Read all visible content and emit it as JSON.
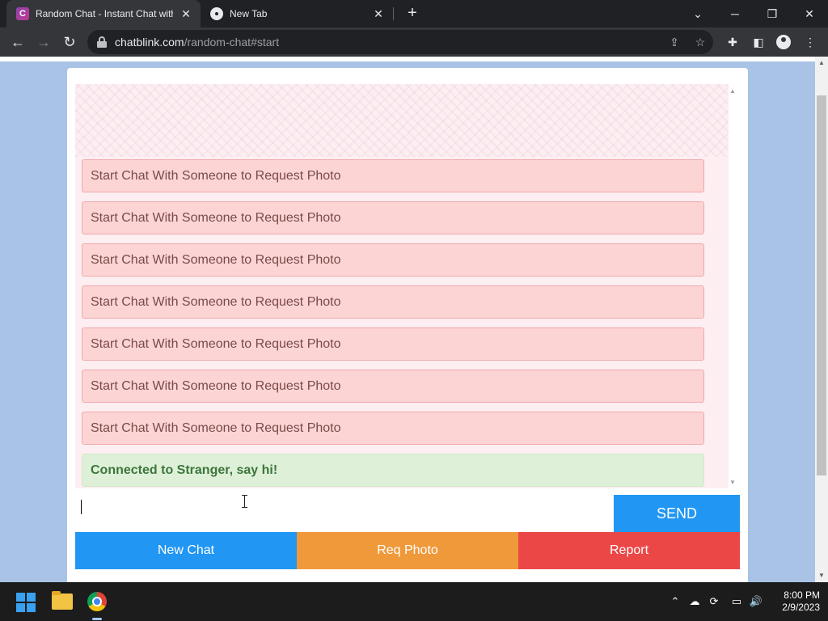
{
  "browser": {
    "tabs": [
      {
        "title": "Random Chat - Instant Chat with",
        "favicon_letter": "C",
        "active": true
      },
      {
        "title": "New Tab",
        "active": false
      }
    ],
    "new_tab_symbol": "+",
    "url_host": "chatblink.com",
    "url_path": "/random-chat#start"
  },
  "chat": {
    "messages": [
      {
        "type": "system-photo",
        "text": "Start Chat With Someone to Request Photo"
      },
      {
        "type": "system-photo",
        "text": "Start Chat With Someone to Request Photo"
      },
      {
        "type": "system-photo",
        "text": "Start Chat With Someone to Request Photo"
      },
      {
        "type": "system-photo",
        "text": "Start Chat With Someone to Request Photo"
      },
      {
        "type": "system-photo",
        "text": "Start Chat With Someone to Request Photo"
      },
      {
        "type": "system-photo",
        "text": "Start Chat With Someone to Request Photo"
      },
      {
        "type": "system-photo",
        "text": "Start Chat With Someone to Request Photo"
      },
      {
        "type": "connected",
        "text": "Connected to Stranger, say hi!"
      }
    ],
    "input_value": "",
    "send_label": "SEND",
    "actions": {
      "new_chat": "New Chat",
      "req_photo": "Req Photo",
      "report": "Report"
    }
  },
  "colors": {
    "send": "#2196f3",
    "new_chat": "#2196f3",
    "req_photo": "#f0993a",
    "report": "#ec4747",
    "photo_msg_bg": "#fdd4d4",
    "connected_msg_bg": "#dff0d8",
    "page_bg": "#a9c3e6"
  },
  "taskbar": {
    "time": "8:00 PM",
    "date": "2/9/2023"
  }
}
